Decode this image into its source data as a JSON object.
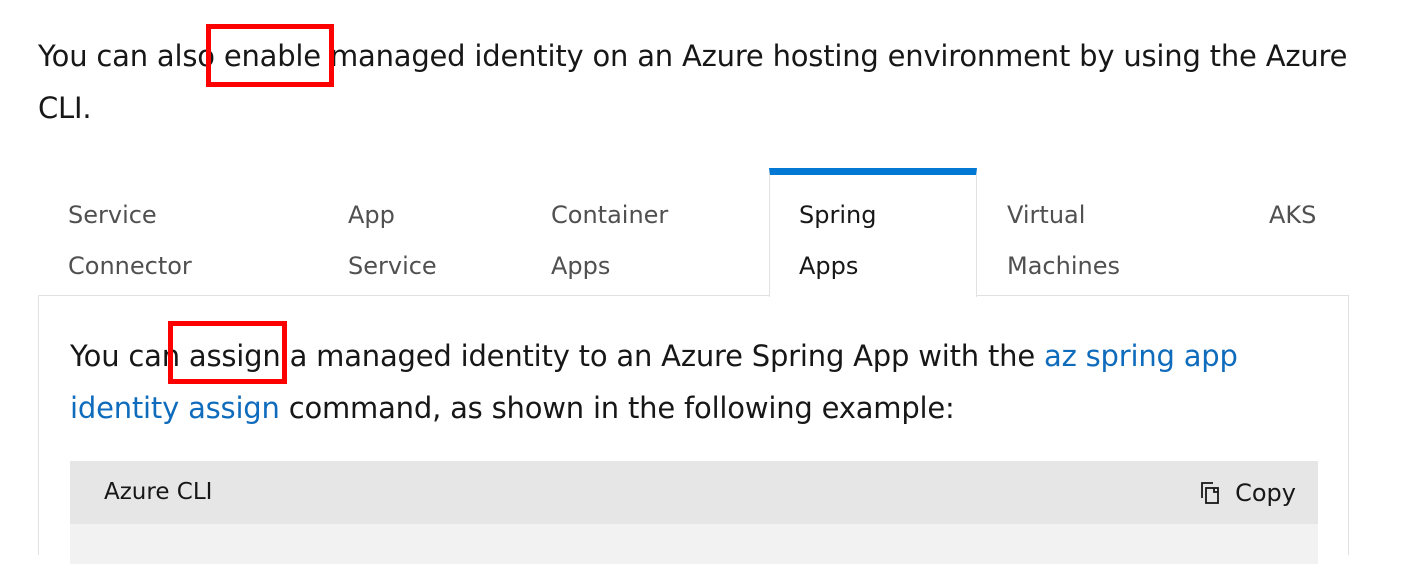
{
  "intro": {
    "before": "You can also ",
    "highlight": "enable ",
    "after": "managed identity on an Azure hosting environment by using the Azure CLI."
  },
  "tabs": [
    {
      "line1": "Service",
      "line2": "Connector"
    },
    {
      "line1": "App",
      "line2": "Service"
    },
    {
      "line1": "Container",
      "line2": "Apps"
    },
    {
      "line1": "Spring",
      "line2": "Apps"
    },
    {
      "line1": "Virtual",
      "line2": "Machines"
    },
    {
      "line1": "AKS",
      "line2": ""
    }
  ],
  "active_tab": "Spring Apps",
  "panel": {
    "text_before": "You can ",
    "highlight": "assign",
    "text_middle": " a managed identity to an Azure Spring App with the ",
    "link": "az spring app identity assign",
    "text_after": " command, as shown in the following example:"
  },
  "code_block": {
    "language": "Azure CLI",
    "copy_label": "Copy",
    "copy_icon": "copy-icon"
  },
  "colors": {
    "accent": "#0078d4",
    "link": "#0f6cbd",
    "highlight_box": "#ff0000",
    "code_header_bg": "#e6e6e6"
  }
}
